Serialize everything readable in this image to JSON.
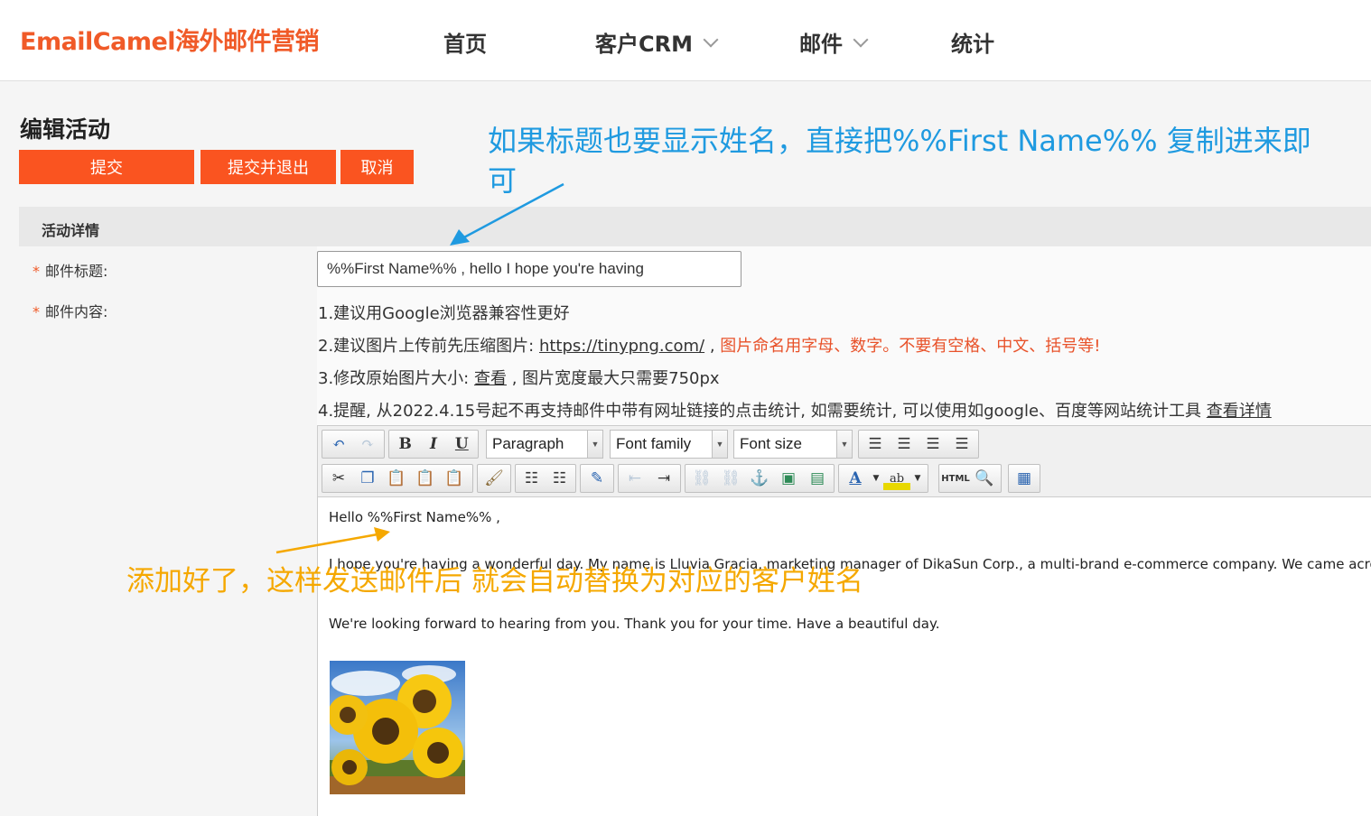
{
  "header": {
    "logo": "EmailCamel海外邮件营销",
    "nav": [
      "首页",
      "客户CRM",
      "邮件",
      "统计"
    ]
  },
  "page": {
    "title": "编辑活动",
    "buttons": {
      "submit": "提交",
      "submit_exit": "提交并退出",
      "cancel": "取消"
    },
    "section_title": "活动详情"
  },
  "form": {
    "subject_label": "邮件标题:",
    "content_label": "邮件内容:",
    "required_mark": "*",
    "subject_value": "%%First Name%% , hello I hope you're having"
  },
  "tips": {
    "tip1": "1.建议用Google浏览器兼容性更好",
    "tip2_prefix": "2.建议图片上传前先压缩图片: ",
    "tip2_link": "https://tinypng.com/",
    "tip2_sep": " , ",
    "tip2_warn": "图片命名用字母、数字。不要有空格、中文、括号等!",
    "tip3_prefix": "3.修改原始图片大小: ",
    "tip3_link": "查看",
    "tip3_suffix": " , 图片宽度最大只需要750px",
    "tip4_prefix": "4.提醒, 从2022.4.15号起不再支持邮件中带有网址链接的点击统计, 如需要统计, 可以使用如google、百度等网站统计工具 ",
    "tip4_link": "查看详情"
  },
  "editor": {
    "format_select": "Paragraph",
    "font_family_select": "Font family",
    "font_size_select": "Font size",
    "html_button": "HTML",
    "body_line1": "Hello %%First Name%% ,",
    "body_line2": "I hope you're having a wonderful day. My name is Lluvia Gracia, marketing manager of DikaSun Corp., a multi-brand e-commerce company. We came across your",
    "body_line3": "We're looking forward to hearing from you. Thank you for your time. Have a beautiful day."
  },
  "annotations": {
    "blue": "如果标题也要显示姓名，直接把%%First Name%% 复制进来即可",
    "yellow": "添加好了，这样发送邮件后 就会自动替换为对应的客户姓名"
  },
  "colors": {
    "brand": "#f05a28",
    "button": "#fa5420",
    "annotation_blue": "#1f9ae0",
    "annotation_yellow": "#f5a800"
  }
}
